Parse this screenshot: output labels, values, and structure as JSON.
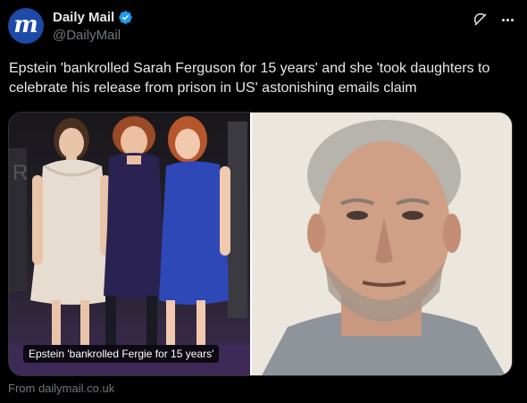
{
  "account": {
    "avatar_letter": "m",
    "avatar_color": "#1d4aa6",
    "name": "Daily Mail",
    "handle": "@DailyMail",
    "verified_color": "#1d9bf0"
  },
  "icons": {
    "grok": "grok-icon",
    "more": "more-icon",
    "verified": "verified-badge-icon"
  },
  "tweet": {
    "text": "Epstein 'bankrolled Sarah Ferguson for 15 years' and she 'took daughters to celebrate his release from prison in US' astonishing emails claim"
  },
  "media": {
    "caption": "Epstein 'bankrolled Fergie for 15 years'",
    "left_alt": "three-women-photo",
    "right_alt": "mugshot-photo"
  },
  "card": {
    "source": "From dailymail.co.uk"
  }
}
